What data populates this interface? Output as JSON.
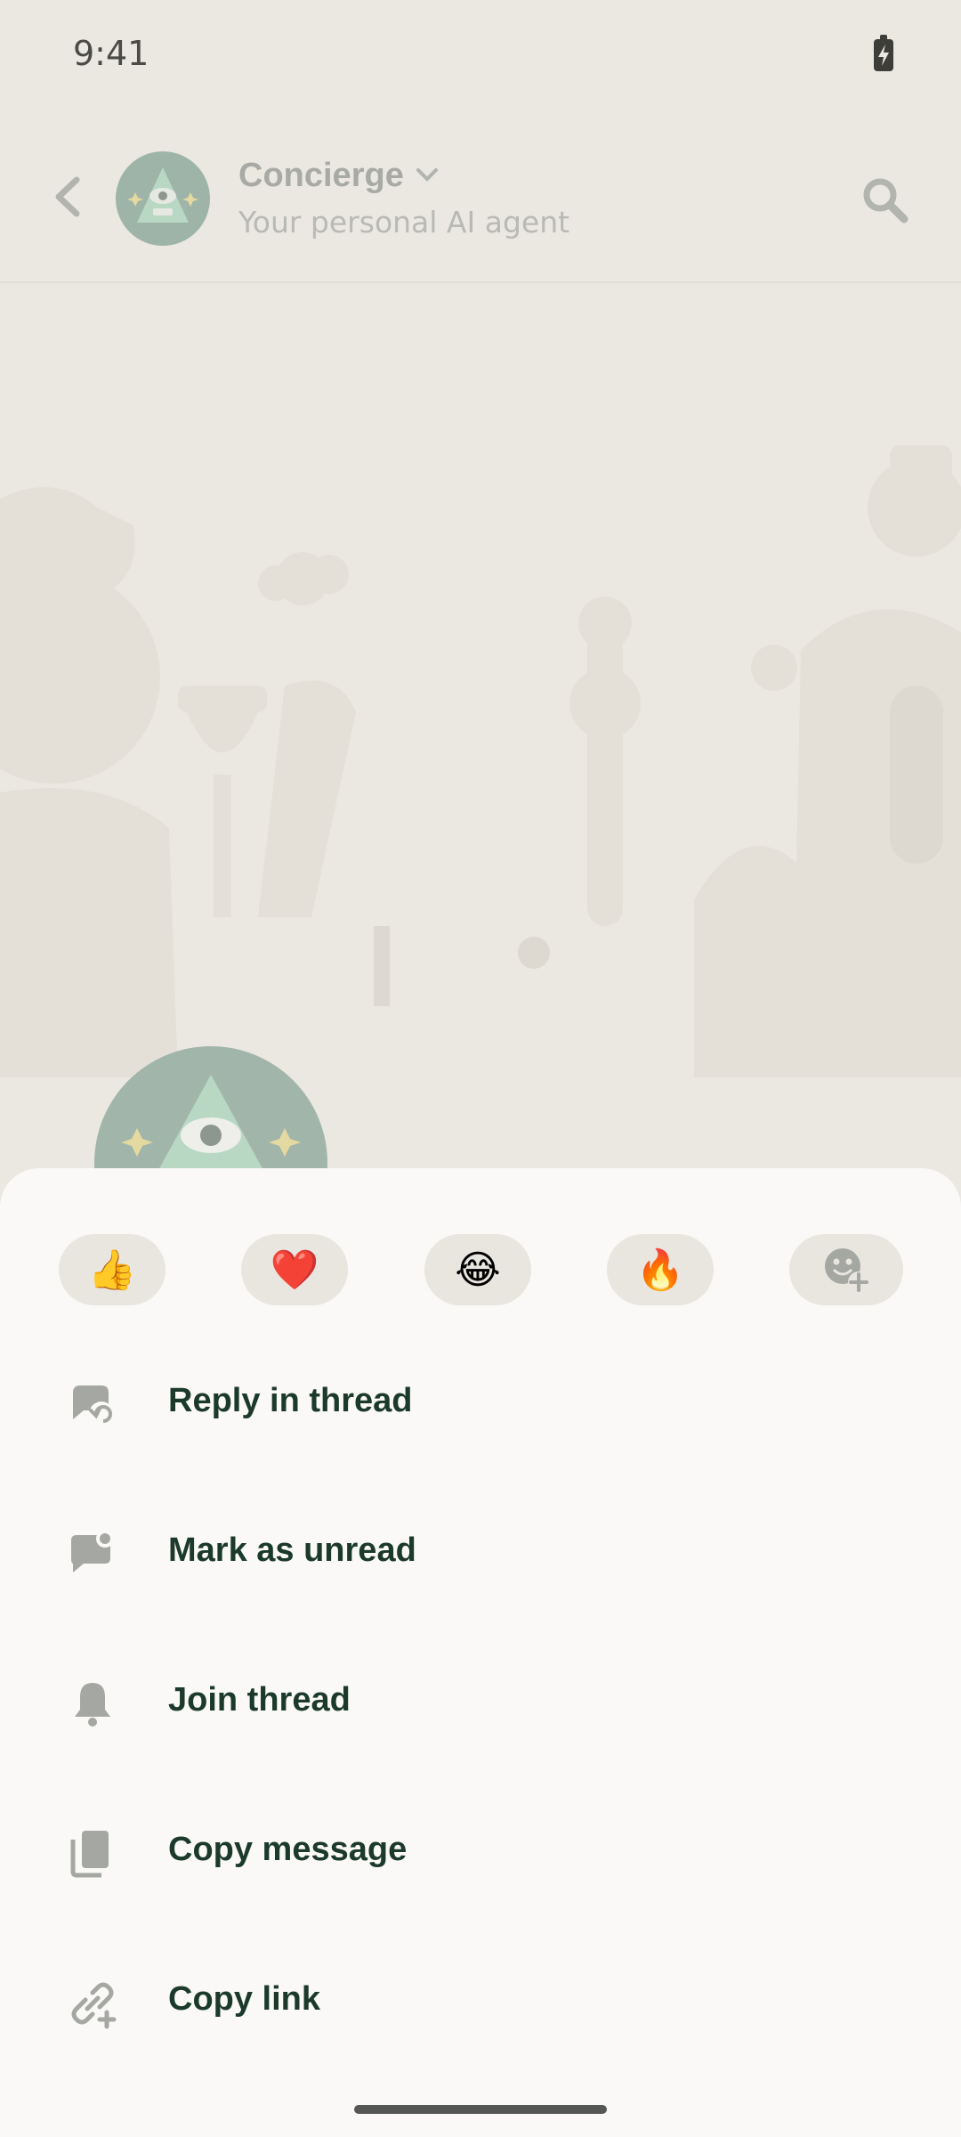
{
  "status_bar": {
    "time": "9:41"
  },
  "header": {
    "title": "Concierge",
    "subtitle": "Your personal AI agent"
  },
  "reactions": [
    {
      "emoji": "👍",
      "name": "thumbs-up"
    },
    {
      "emoji": "❤️",
      "name": "heart"
    },
    {
      "emoji": "😂",
      "name": "tears-of-joy"
    },
    {
      "emoji": "🔥",
      "name": "fire"
    }
  ],
  "menu": {
    "reply_in_thread": "Reply in thread",
    "mark_as_unread": "Mark as unread",
    "join_thread": "Join thread",
    "copy_message": "Copy message",
    "copy_link": "Copy link"
  },
  "colors": {
    "background": "#ebe8e2",
    "sheet": "#faf9f7",
    "menu_text": "#1c3a2c",
    "icon_gray": "#a4a7a2",
    "avatar_green": "#9fb4a8"
  }
}
